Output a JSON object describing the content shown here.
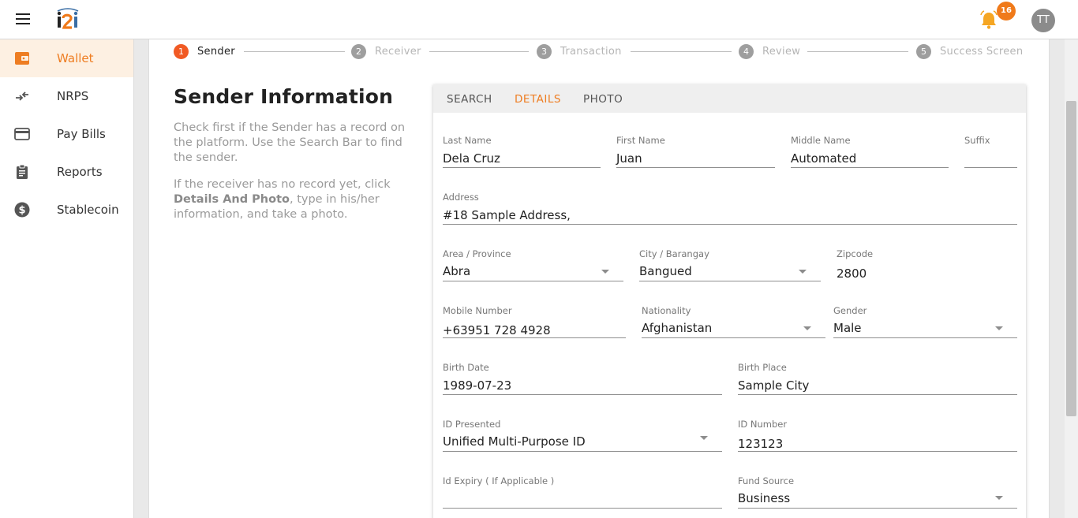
{
  "header": {
    "menu_icon": "hamburger-icon",
    "logo": "i2i",
    "notification_count": "16",
    "avatar_initials": "TT"
  },
  "sidebar": {
    "items": [
      {
        "label": "Wallet",
        "icon": "wallet-icon",
        "active": true
      },
      {
        "label": "NRPS",
        "icon": "transfer-arrows-icon"
      },
      {
        "label": "Pay Bills",
        "icon": "credit-card-icon"
      },
      {
        "label": "Reports",
        "icon": "clipboard-icon"
      },
      {
        "label": "Stablecoin",
        "icon": "dollar-circle-icon"
      }
    ]
  },
  "stepper": {
    "steps": [
      {
        "num": "1",
        "label": "Sender",
        "active": true
      },
      {
        "num": "2",
        "label": "Receiver"
      },
      {
        "num": "3",
        "label": "Transaction"
      },
      {
        "num": "4",
        "label": "Review"
      },
      {
        "num": "5",
        "label": "Success Screen"
      }
    ]
  },
  "info": {
    "title": "Sender Information",
    "desc1": "Check first if the Sender has a record on the platform. Use the Search Bar to find the sender.",
    "desc2_pre": "If the receiver has no record yet, click ",
    "desc2_bold": "Details And Photo",
    "desc2_post": ", type in his/her information, and take a photo."
  },
  "tabs": [
    {
      "label": "SEARCH"
    },
    {
      "label": "DETAILS",
      "active": true
    },
    {
      "label": "PHOTO"
    }
  ],
  "form": {
    "last_name": {
      "label": "Last Name",
      "value": "Dela Cruz"
    },
    "first_name": {
      "label": "First Name",
      "value": "Juan"
    },
    "middle_name": {
      "label": "Middle Name",
      "value": "Automated"
    },
    "suffix": {
      "label": "Suffix",
      "value": ""
    },
    "address": {
      "label": "Address",
      "value": "#18 Sample Address,"
    },
    "area": {
      "label": "Area / Province",
      "value": "Abra"
    },
    "city": {
      "label": "City / Barangay",
      "value": "Bangued"
    },
    "zipcode": {
      "label": "Zipcode",
      "value": "2800"
    },
    "mobile": {
      "label": "Mobile Number",
      "value": "+63951 728 4928"
    },
    "nationality": {
      "label": "Nationality",
      "value": "Afghanistan"
    },
    "gender": {
      "label": "Gender",
      "value": "Male"
    },
    "birth_date": {
      "label": "Birth Date",
      "value": "1989-07-23"
    },
    "birth_place": {
      "label": "Birth Place",
      "value": "Sample City"
    },
    "id_presented": {
      "label": "ID Presented",
      "value": "Unified Multi-Purpose ID"
    },
    "id_number": {
      "label": "ID Number",
      "value": "123123"
    },
    "id_expiry": {
      "label": "Id Expiry ( If Applicable )",
      "value": ""
    },
    "fund_source": {
      "label": "Fund Source",
      "value": "Business"
    }
  },
  "colors": {
    "accent": "#ee7d22",
    "step_active": "#f15a24",
    "badge": "#f07a1a",
    "bell": "#f5a623"
  }
}
